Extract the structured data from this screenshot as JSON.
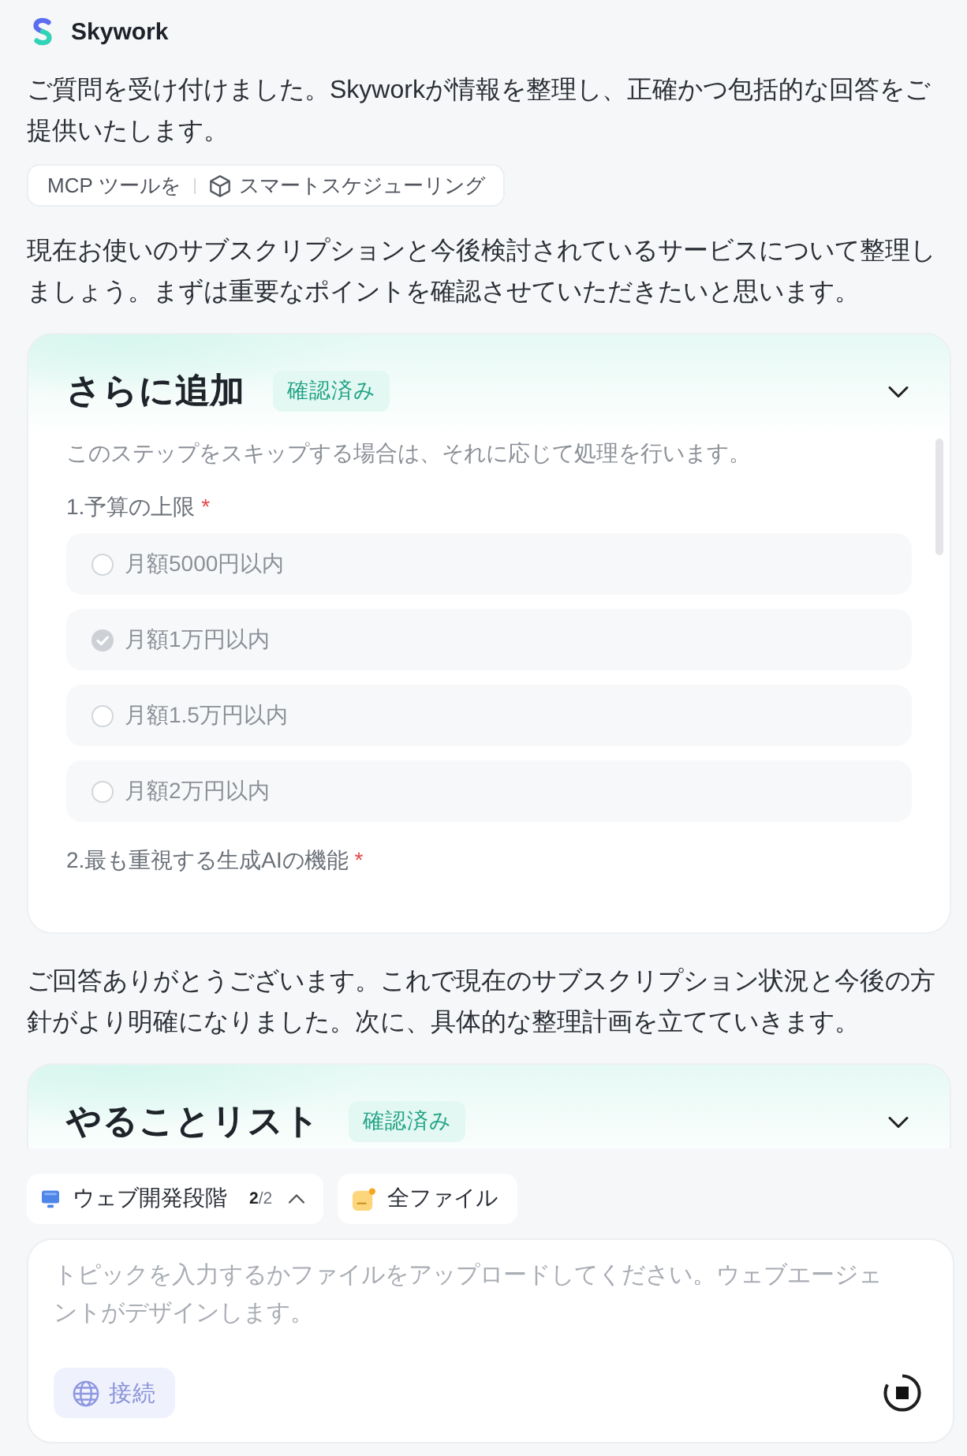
{
  "header": {
    "app_name": "Skywork"
  },
  "thread": [
    {
      "kind": "text",
      "text": "ご質問を受け付けました。Skyworkが情報を整理し、正確かつ包括的な回答をご提供いたします。"
    },
    {
      "kind": "tools",
      "label": "MCP ツールを",
      "tools": [
        "スマートスケジューリング"
      ]
    },
    {
      "kind": "text",
      "text": "現在お使いのサブスクリプションと今後検討されているサービスについて整理しましょう。まずは重要なポイントを確認させていただきたいと思います。"
    },
    {
      "kind": "card",
      "title": "さらに追加",
      "badge": "確認済み",
      "note": "このステップをスキップする場合は、それに応じて処理を行います。",
      "questions": [
        {
          "label": "1.予算の上限",
          "required_mark": "*",
          "options": [
            {
              "label": "月額5000円以内",
              "selected": false
            },
            {
              "label": "月額1万円以内",
              "selected": true
            },
            {
              "label": "月額1.5万円以内",
              "selected": false
            },
            {
              "label": "月額2万円以内",
              "selected": false
            }
          ]
        },
        {
          "label": "2.最も重視する生成AIの機能",
          "required_mark": "*"
        }
      ]
    },
    {
      "kind": "text",
      "text": "ご回答ありがとうございます。これで現在のサブスクリプション状況と今後の方針がより明確になりました。次に、具体的な整理計画を立てていきます。"
    },
    {
      "kind": "card",
      "title": "やることリスト",
      "badge": "確認済み"
    }
  ],
  "composer": {
    "chips": [
      {
        "kind": "stage",
        "label": "ウェブ開発段階",
        "counter": "**2**/2"
      },
      {
        "kind": "files",
        "label": "全ファイル"
      }
    ],
    "input": {
      "placeholder": "トピックを入力するかファイルをアップロードしてください。ウェブエージェントがデザインします。"
    },
    "connect_button": "接続"
  }
}
